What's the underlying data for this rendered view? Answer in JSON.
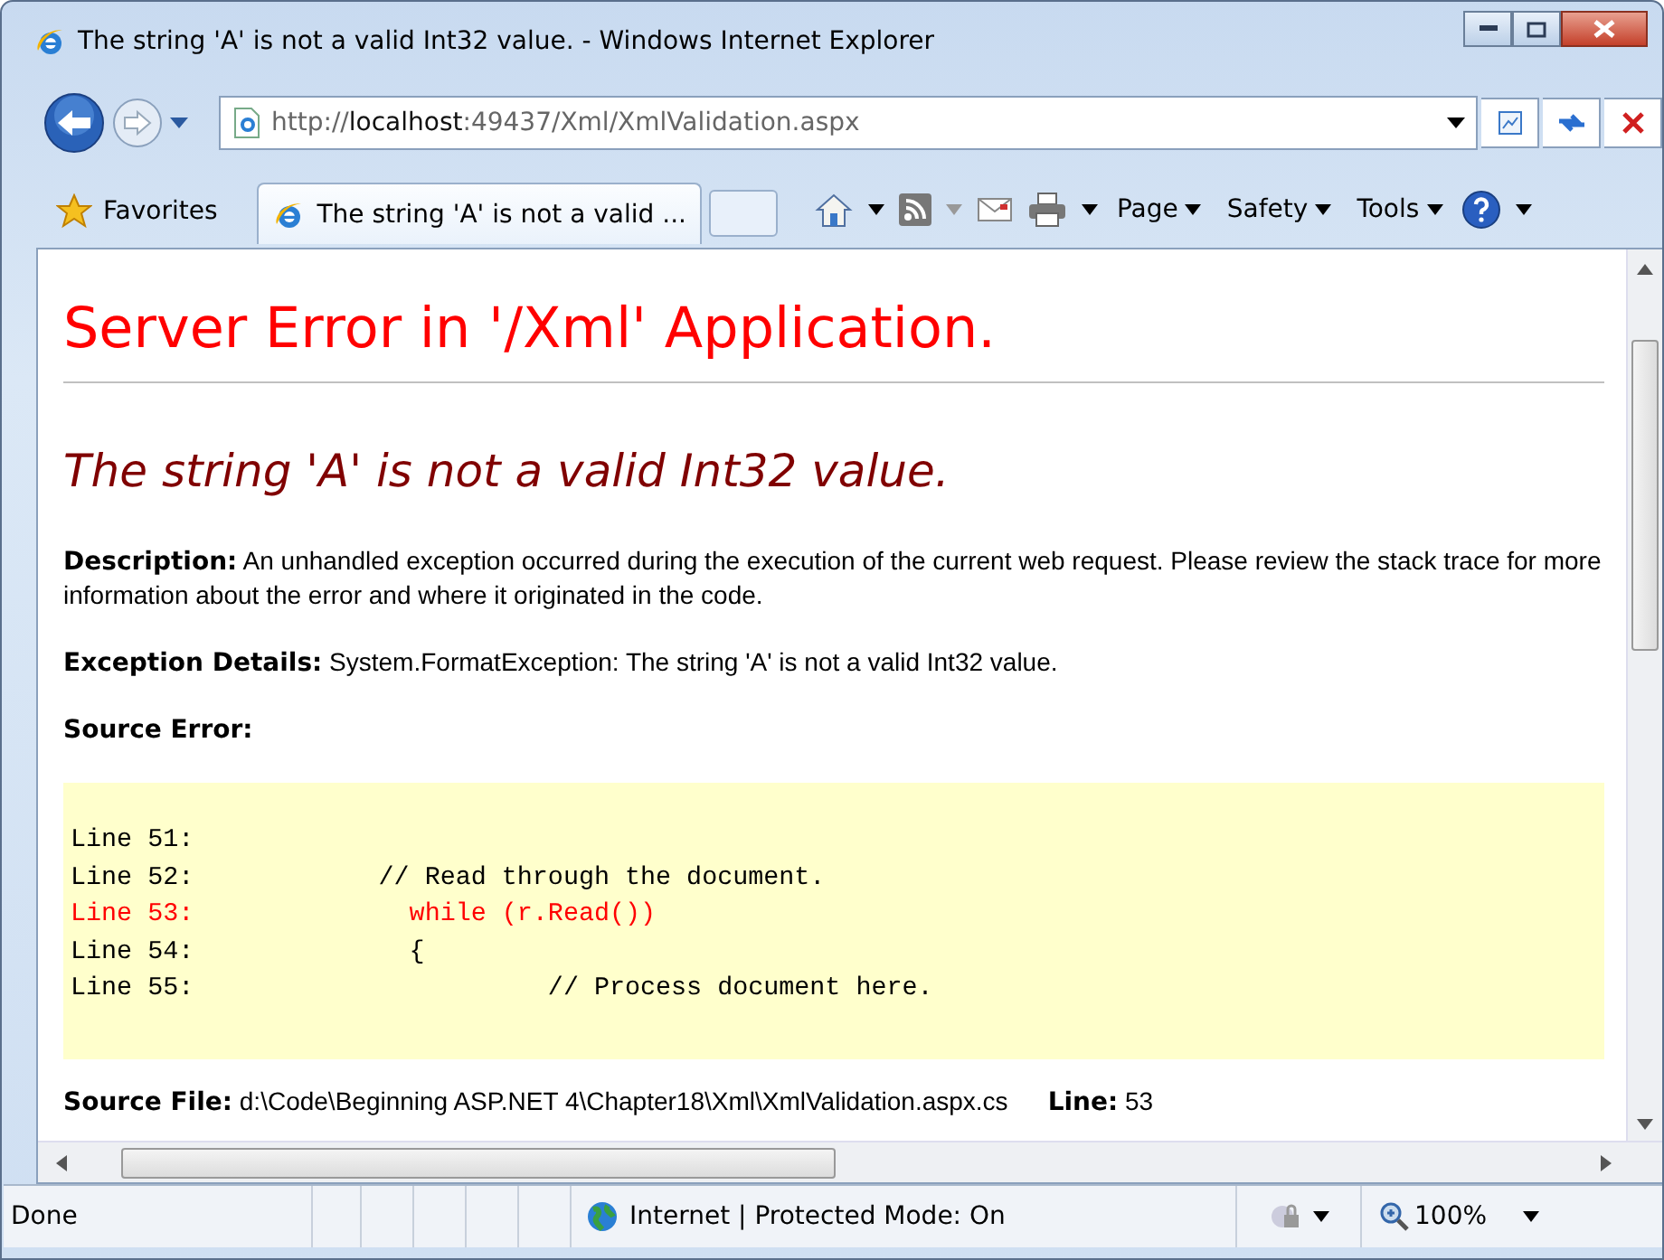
{
  "window": {
    "title": "The string 'A' is not a valid Int32 value. - Windows Internet Explorer"
  },
  "address_bar": {
    "url": "http://**localhost**:49437/Xml/XmlValidation.aspx"
  },
  "favorites": {
    "label": "Favorites"
  },
  "tabs": [
    {
      "title": "The string 'A' is not a valid ...",
      "selected": true
    }
  ],
  "command_bar": [
    {
      "label": "Page"
    },
    {
      "label": "Safety"
    },
    {
      "label": "Tools"
    }
  ],
  "page": {
    "heading": "Server Error in '/Xml' Application.",
    "error_title": "The string 'A' is not a valid Int32 value.",
    "details": [
      {
        "label": "Description:",
        "text": "An unhandled exception occurred during the execution of the current web request. Please review the stack trace for more information about the error and where it originated in the code."
      },
      {
        "label": "Exception Details:",
        "text": "System.FormatException: The string 'A' is not a valid Int32 value."
      }
    ],
    "source_error_label": "Source Error:",
    "code_lines": [
      {
        "number": "Line 51:",
        "highlighted": false
      },
      {
        "number": "Line 52:",
        "code": "          // Read through the document.",
        "highlighted": false
      },
      {
        "number": "Line 53:",
        "code": "            while (r.Read())",
        "highlighted": true
      },
      {
        "number": "Line 54:",
        "code": "            {",
        "highlighted": false
      },
      {
        "number": "Line 55:",
        "code": "                     // Process document here.",
        "highlighted": false
      }
    ],
    "source_file_label": "Source File:",
    "source_file": "d:\\Code\\Beginning ASP.NET 4\\Chapter18\\Xml\\XmlValidation.aspx.cs",
    "line_label": "Line:",
    "line": "53"
  },
  "status_bar": {
    "text": "Done",
    "zone": "Internet | Protected Mode: On",
    "zoom": "100%"
  }
}
